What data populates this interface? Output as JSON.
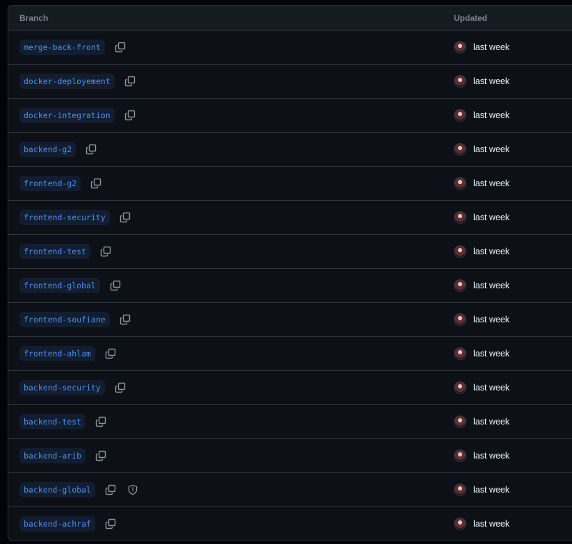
{
  "header": {
    "branch_label": "Branch",
    "updated_label": "Updated"
  },
  "icons": {
    "copy": "copy-icon",
    "shield": "shield-icon",
    "avatar": "avatar"
  },
  "colors": {
    "background": "#0d1117",
    "header_bg": "#161b22",
    "border": "#30363d",
    "branch_text": "#4493f8",
    "branch_bg": "#121d2f",
    "muted_text": "#7d8590",
    "text": "#e6edf3"
  },
  "rows": [
    {
      "branch": "merge-back-front",
      "updated": "last week",
      "protected": false
    },
    {
      "branch": "docker-deployement",
      "updated": "last week",
      "protected": false
    },
    {
      "branch": "docker-integration",
      "updated": "last week",
      "protected": false
    },
    {
      "branch": "backend-g2",
      "updated": "last week",
      "protected": false
    },
    {
      "branch": "frontend-g2",
      "updated": "last week",
      "protected": false
    },
    {
      "branch": "frontend-security",
      "updated": "last week",
      "protected": false
    },
    {
      "branch": "frontend-test",
      "updated": "last week",
      "protected": false
    },
    {
      "branch": "frontend-global",
      "updated": "last week",
      "protected": false
    },
    {
      "branch": "frontend-soufiane",
      "updated": "last week",
      "protected": false
    },
    {
      "branch": "frontend-ahlam",
      "updated": "last week",
      "protected": false
    },
    {
      "branch": "backend-security",
      "updated": "last week",
      "protected": false
    },
    {
      "branch": "backend-test",
      "updated": "last week",
      "protected": false
    },
    {
      "branch": "backend-arib",
      "updated": "last week",
      "protected": false
    },
    {
      "branch": "backend-global",
      "updated": "last week",
      "protected": true
    },
    {
      "branch": "backend-achraf",
      "updated": "last week",
      "protected": false
    }
  ]
}
